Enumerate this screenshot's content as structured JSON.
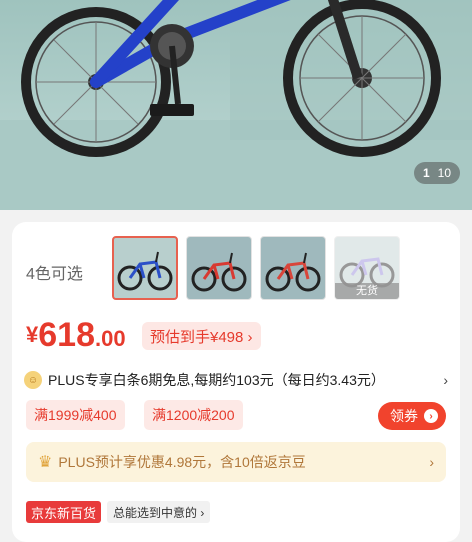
{
  "gallery": {
    "current": "1",
    "total": "10"
  },
  "colors": {
    "label": "4色可选",
    "options": [
      {
        "name": "blue",
        "color": "#2b50c8",
        "selected": true,
        "sold_out": false
      },
      {
        "name": "red",
        "color": "#d83a32",
        "selected": false,
        "sold_out": false
      },
      {
        "name": "red-2",
        "color": "#d8453a",
        "selected": false,
        "sold_out": false
      },
      {
        "name": "purple",
        "color": "#a69be0",
        "selected": false,
        "sold_out": true
      }
    ],
    "sold_out_label": "无货"
  },
  "price": {
    "symbol": "¥",
    "integer": "618",
    "decimal": ".00",
    "estimate": "预估到手¥498 ›"
  },
  "plus_row": {
    "icon": "plus-badge-icon",
    "text": "PLUS专享白条6期免息,每期约103元（每日约3.43元）",
    "chevron": "›"
  },
  "coupons": {
    "items": [
      "满1999减400",
      "满1200减200"
    ],
    "get_label": "领券"
  },
  "plus_banner": {
    "text": "PLUS预计享优惠4.98元，含10倍返京豆",
    "chevron": "›"
  },
  "bottom": {
    "jd_tag": "京东新百货",
    "gray_tag": "总能选到中意的 ›"
  },
  "theme": {
    "accent": "#e63a2c",
    "coupon_bg": "#fde9e6",
    "plus_bg": "#fcf3dc"
  }
}
